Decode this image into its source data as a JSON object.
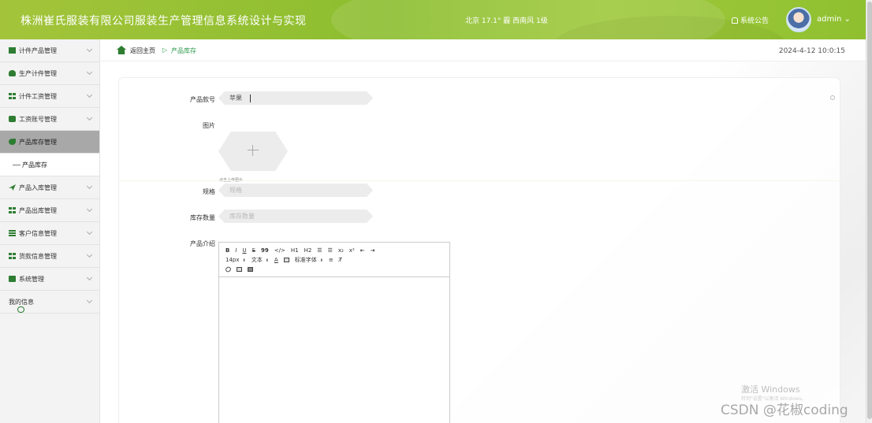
{
  "header": {
    "title": "株洲崔氏服装有限公司服装生产管理信息系统设计与实现",
    "weather": "北京 17.1° 霾 西南风 1级",
    "notice": "系统公告",
    "user": "admin"
  },
  "sidebar": {
    "items": [
      {
        "label": "计件产品管理"
      },
      {
        "label": "生产计件管理"
      },
      {
        "label": "计件工资管理"
      },
      {
        "label": "工资账号管理"
      },
      {
        "label": "产品库存管理"
      },
      {
        "label": "产品库存"
      },
      {
        "label": "产品入库管理"
      },
      {
        "label": "产品出库管理"
      },
      {
        "label": "客户信息管理"
      },
      {
        "label": "货款信息管理"
      },
      {
        "label": "系统管理"
      },
      {
        "label": "我的信息"
      }
    ]
  },
  "breadcrumb": {
    "home": "返回主页",
    "separator": "▷",
    "current": "产品库存"
  },
  "datetime": "2024-4-12 10:0:15",
  "form": {
    "product_no_label": "产品款号",
    "product_no_value": "苹果",
    "image_label": "图片",
    "upload_hint": "点击上传图片",
    "spec_label": "规格",
    "spec_placeholder": "规格",
    "stock_label": "库存数量",
    "stock_placeholder": "库存数量",
    "intro_label": "产品介绍"
  },
  "editor": {
    "row1": [
      "B",
      "I",
      "U",
      "S",
      "99",
      "</>",
      "H1",
      "H2",
      "☰",
      "☰",
      "x₂",
      "x²",
      "⇤",
      "⇥"
    ],
    "font_size": "14px",
    "text_style": "文本",
    "font_family": "标准字体"
  },
  "watermark": {
    "line1": "激活 Windows",
    "line2": "转到\"设置\"以激活 Windows。",
    "csdn": "CSDN @花椒coding"
  }
}
